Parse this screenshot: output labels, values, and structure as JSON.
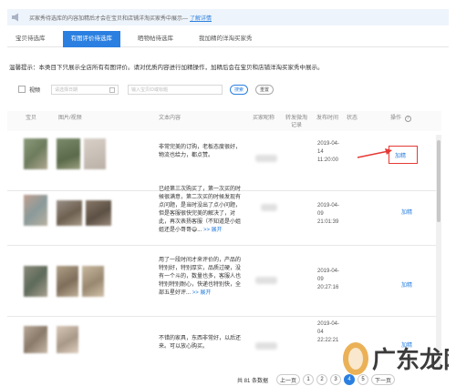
{
  "banner": {
    "text": "买家秀待选库的内容加精后才会在宝贝和店铺洋淘买家秀中展示—",
    "link": "了解详情"
  },
  "tabs": [
    {
      "label": "宝贝待选库"
    },
    {
      "label": "有图评价待选库"
    },
    {
      "label": "晒物帖待选库"
    },
    {
      "label": "我加精的洋淘买家秀"
    }
  ],
  "tip": "温馨提示：本类目下只展示全店所有有图评价。请对优质内容进行加精操作，加精后会在宝贝和店铺洋淘买家秀中展示。",
  "filters": {
    "video_label": "视频",
    "date_placeholder": "请选择日期",
    "search_placeholder": "输入宝贝ID或标题",
    "search_btn": "搜索",
    "reset_btn": "重置"
  },
  "columns": [
    "宝贝",
    "图片/视频",
    "文本内容",
    "买家昵称",
    "转发微淘记录",
    "发布时间",
    "状态",
    "操作"
  ],
  "rows": [
    {
      "text": "非常完美的订购，老板态度很好，物流也给力，都点赞。",
      "more": "",
      "time": "2019-04-14 11:20:00",
      "action": "加精"
    },
    {
      "text": "已经第三次购买了，第一次买的时候很满意，第二次买的时候发现有点问题，是当时没出了点小问题，但是客服很快完美的解决了，对此，再次表扬客服（不知道是小姐姐还是小哥哥😄...",
      "more": ">> 展开",
      "time": "2019-04-09 21:01:39",
      "action": "加精"
    },
    {
      "text": "用了一段时间才来评价的，产品的特别好，特别厚实，品质过硬，没有一个斗的，数量也多，客服人也特别特别耐心，快递也特别快，全部五星好评...",
      "more": ">> 展开",
      "time": "2019-04-09 20:27:16",
      "action": "加精"
    },
    {
      "text": "不错的家具，东西非常好，以后还来。可以放心购买。",
      "more": "",
      "time": "2019-04-04 22:22:21",
      "action": "加精"
    }
  ],
  "pagination": {
    "total": "共 81 条数据",
    "prev": "上一页",
    "pages": [
      "1",
      "2",
      "3",
      "4",
      "5"
    ],
    "current": "4",
    "next": "下一页"
  },
  "watermark": "广东龙网",
  "colors": {
    "accent": "#2a7fe0",
    "highlight": "#e53935"
  }
}
